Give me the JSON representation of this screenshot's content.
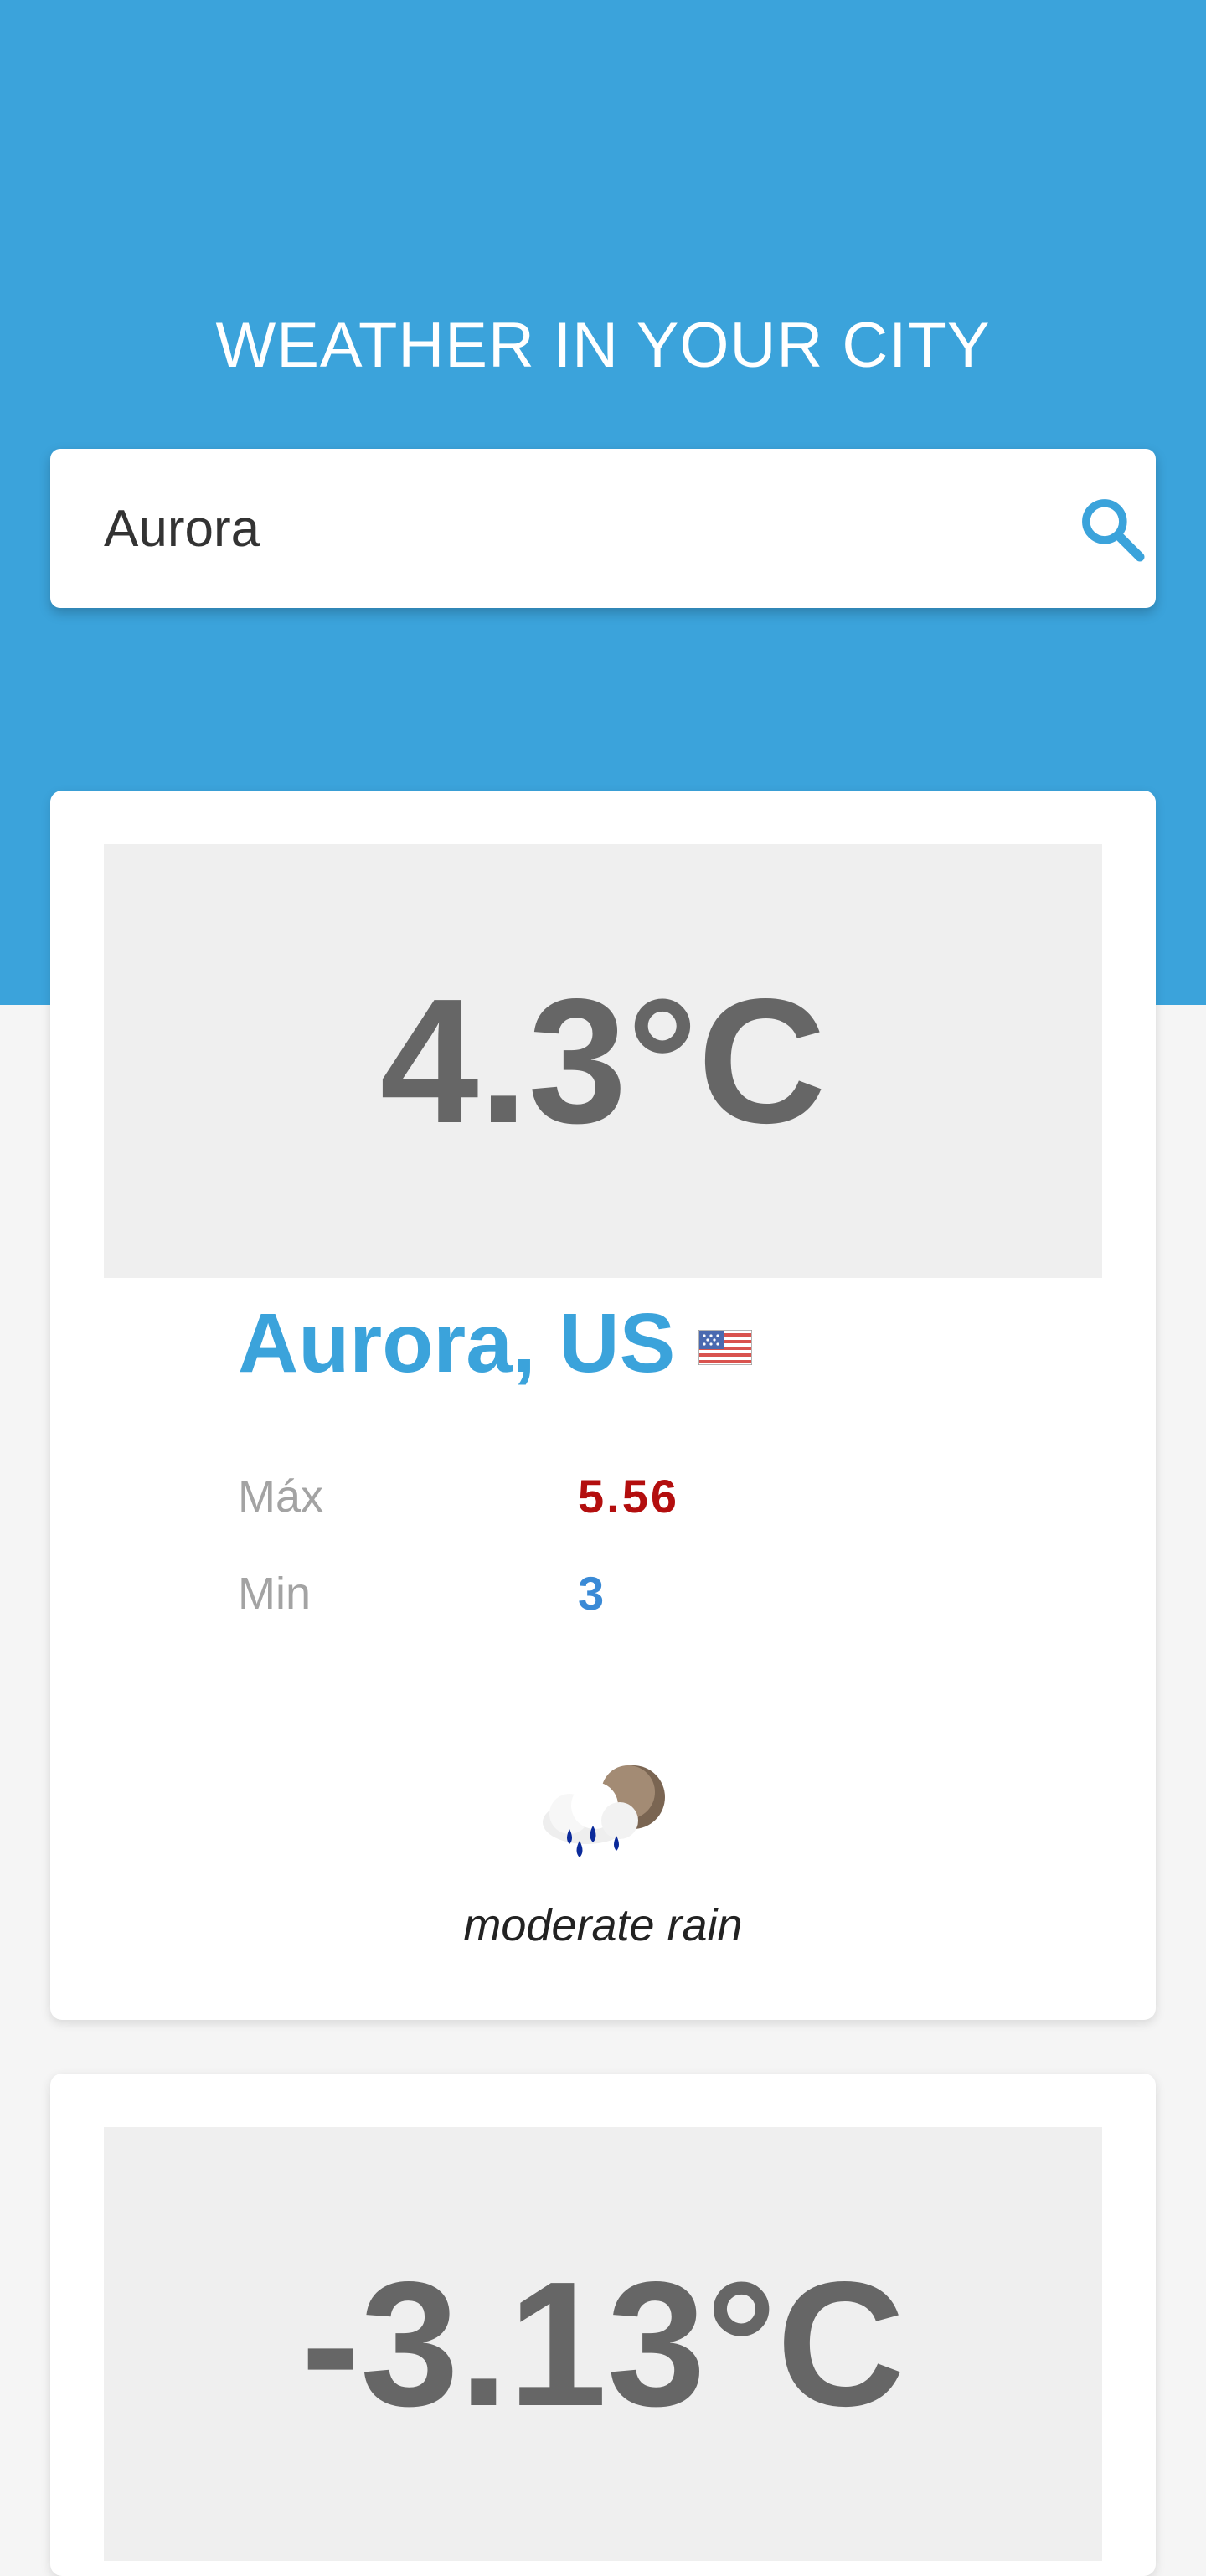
{
  "header": {
    "title": "WEATHER IN YOUR CITY",
    "background_color": "#3ba3db"
  },
  "search": {
    "value": "Aurora",
    "icon": "search-icon"
  },
  "results": [
    {
      "temperature": "4.3°C",
      "city": "Aurora, US",
      "flag_icon": "us-flag-icon",
      "max_label": "Máx",
      "max_value": "5.56",
      "min_label": "Min",
      "min_value": "3",
      "weather_icon": "rain-cloud-moon-icon",
      "description": "moderate rain",
      "colors": {
        "city": "#3ba3db",
        "max": "#b30e0e",
        "min": "#3a8ad6"
      }
    },
    {
      "temperature": "-3.13°C"
    }
  ]
}
